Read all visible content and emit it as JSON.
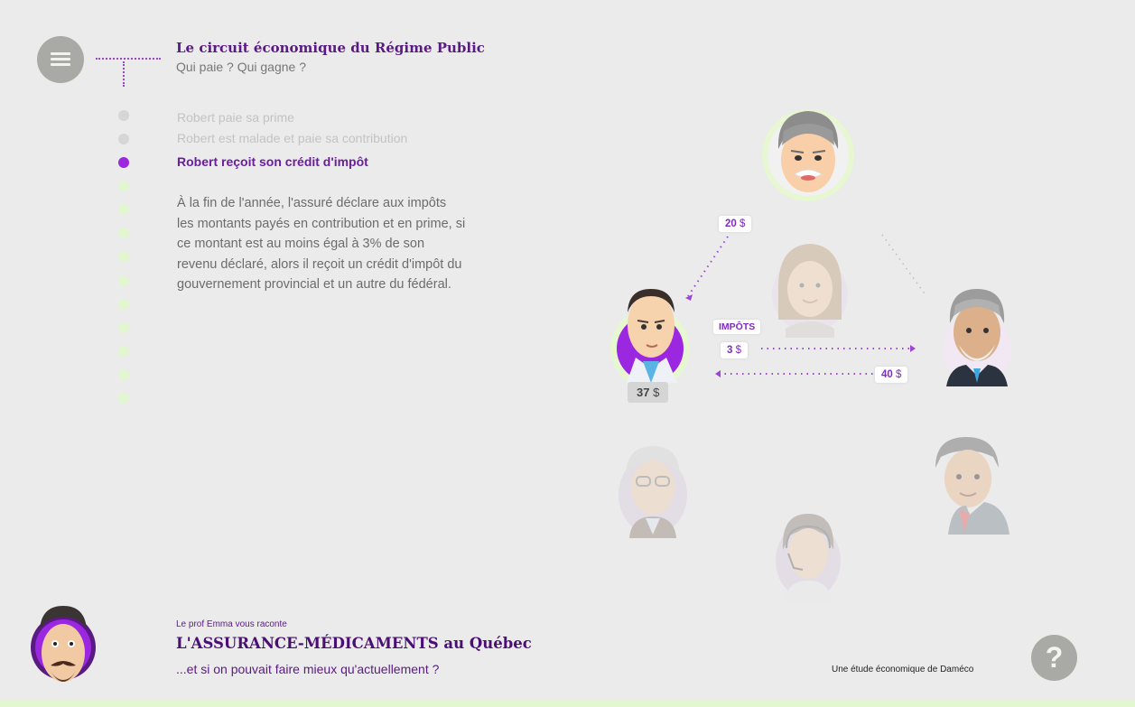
{
  "header": {
    "title": "Le circuit économique du Régime Public",
    "subtitle": "Qui paie ? Qui gagne ?",
    "menu_icon": "hamburger-icon"
  },
  "steps": [
    {
      "label": "Robert paie sa prime",
      "state": "done"
    },
    {
      "label": "Robert est malade et paie sa contribution",
      "state": "done"
    },
    {
      "label": "Robert reçoit son crédit d'impôt",
      "state": "active"
    },
    {
      "label": "",
      "state": "upcoming"
    },
    {
      "label": "",
      "state": "upcoming"
    },
    {
      "label": "",
      "state": "upcoming"
    },
    {
      "label": "",
      "state": "upcoming"
    },
    {
      "label": "",
      "state": "upcoming"
    },
    {
      "label": "",
      "state": "upcoming"
    },
    {
      "label": "",
      "state": "upcoming"
    },
    {
      "label": "",
      "state": "upcoming"
    },
    {
      "label": "",
      "state": "upcoming"
    },
    {
      "label": "",
      "state": "upcoming"
    }
  ],
  "description": "À la fin de l'année, l'assuré déclare aux impôts les montants payés en contribution et en prime, si ce montant est au moins égal à 3% de son revenu déclaré, alors il reçoit un crédit d'impôt du gouvernement provincial et un autre du fédéral.",
  "diagram": {
    "tag_20": {
      "amount": "20",
      "currency": "$"
    },
    "tag_impots": "IMPÔTS",
    "tag_3": {
      "amount": "3",
      "currency": "$"
    },
    "tag_40": {
      "amount": "40",
      "currency": "$"
    },
    "robert_balance": {
      "amount": "37",
      "currency": "$"
    }
  },
  "footer": {
    "small": "Le prof Emma vous raconte",
    "title": "L'ASSURANCE-MÉDICAMENTS au Québec",
    "subtitle": "...et si on pouvait faire mieux qu'actuellement ?",
    "credit": "Une étude économique de Daméco",
    "help_label": "?"
  },
  "colors": {
    "accent_purple": "#9b27e0",
    "dark_purple": "#4a0f73",
    "pale_green": "#e2f6d0",
    "grey_button": "#a9a9a6"
  }
}
